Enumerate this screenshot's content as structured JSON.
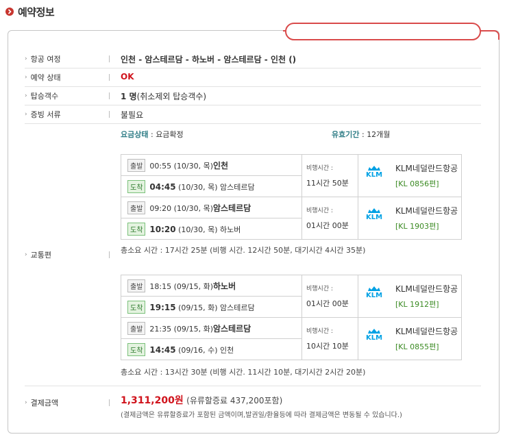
{
  "page": {
    "title": "예약정보"
  },
  "rows": {
    "itinerary": {
      "label": "항공 여정",
      "value": "인천 - 암스테르담 - 하노버 - 암스테르담 - 인천  ()"
    },
    "status": {
      "label": "예약 상태",
      "value": "OK"
    },
    "passengers": {
      "label": "탑승객수",
      "count": "1 명",
      "note": "(취소제외 탑승객수)"
    },
    "documents": {
      "label": "증빙 서류",
      "value": "불필요"
    },
    "transport": {
      "label": "교통편"
    },
    "payment": {
      "label": "결제금액"
    }
  },
  "fare": {
    "status_label": "요금상태",
    "status_value": "요금확정",
    "validity_label": "유효기간",
    "validity_value": "12개월"
  },
  "outbound": {
    "legs": [
      {
        "dep_tag": "출발",
        "dep_time": "00:55",
        "dep_date": "(10/30, 목)",
        "dep_city": "인천",
        "arr_tag": "도착",
        "arr_time": "04:45",
        "arr_date": "(10/30, 목)",
        "arr_city": "암스테르담",
        "dur_label": "비행시간 :",
        "duration": "11시간 50분",
        "airline": "KLM네덜란드항공",
        "flight": "[KL 0856편]"
      },
      {
        "dep_tag": "출발",
        "dep_time": "09:20",
        "dep_date": "(10/30, 목)",
        "dep_city": "암스테르담",
        "arr_tag": "도착",
        "arr_time": "10:20",
        "arr_date": "(10/30, 목)",
        "arr_city": "하노버",
        "dur_label": "비행시간 :",
        "duration": "01시간 00분",
        "airline": "KLM네덜란드항공",
        "flight": "[KL 1903편]"
      }
    ],
    "total": "총소요 시간 : 17시간 25분 (비행 시간. 12시간 50분, 대기시간 4시간 35분)"
  },
  "inbound": {
    "legs": [
      {
        "dep_tag": "출발",
        "dep_time": "18:15",
        "dep_date": "(09/15, 화)",
        "dep_city": "하노버",
        "arr_tag": "도착",
        "arr_time": "19:15",
        "arr_date": "(09/15, 화)",
        "arr_city": "암스테르담",
        "dur_label": "비행시간 :",
        "duration": "01시간 00분",
        "airline": "KLM네덜란드항공",
        "flight": "[KL 1912편]"
      },
      {
        "dep_tag": "출발",
        "dep_time": "21:35",
        "dep_date": "(09/15, 화)",
        "dep_city": "암스테르담",
        "arr_tag": "도착",
        "arr_time": "14:45",
        "arr_date": "(09/16, 수)",
        "arr_city": "인천",
        "dur_label": "비행시간 :",
        "duration": "10시간 10분",
        "airline": "KLM네덜란드항공",
        "flight": "[KL 0855편]"
      }
    ],
    "total": "총소요 시간 : 13시간 30분 (비행 시간. 11시간 10분, 대기시간 2시간 20분)"
  },
  "airline_logo_text": "KLM",
  "payment": {
    "amount": "1,311,200원",
    "fuel": "(유류할증료 437,200포함)",
    "note": "(결제금액은 유류할증료가 포함된 금액이며,발권일/환율등에 따라 결제금액은 변동될 수 있습니다.)"
  },
  "colors": {
    "accent_red": "#d0121b",
    "teal": "#2f7d86",
    "klm_blue": "#00a1e4",
    "flight_green": "#3a8a22"
  },
  "icons": {
    "header": "chevron-right-icon",
    "airline": "klm-crown-icon"
  }
}
